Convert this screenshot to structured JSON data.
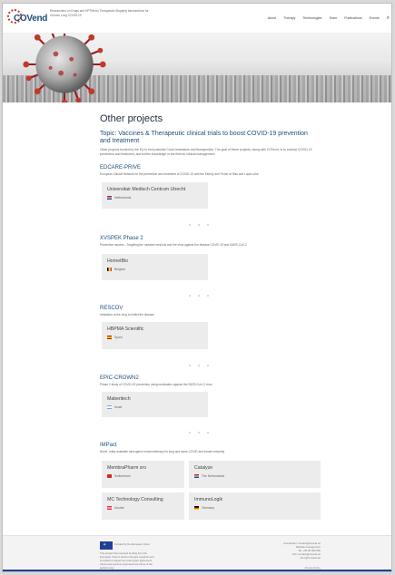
{
  "header": {
    "logo_text": "COVend",
    "tagline": "Researchers on Drugs and HPTMeUs Therapeutic Stopping Interventions for Chronic Long COVID-19",
    "nav": [
      "About",
      "Therapy",
      "Technologies",
      "Team",
      "Publications",
      "Events"
    ],
    "search_icon": "search-icon"
  },
  "main": {
    "title": "Other projects",
    "subtitle": "Topic: Vaccines & Therapeutic clinical trials to boost COVID-19 prevention and treatment",
    "intro": "Other projects funded by the EU to find potential Covid treatments and therapeutics. The goal of these projects, along with COVend, is to combat COVID-19 prevention and treatment, and further knowledge in the field for clinical management."
  },
  "projects": [
    {
      "title": "EDCARE-PRIVE",
      "description": "European Clinical Network for the prevention and treatment of COVID-19 with the Elderly and Those at Risk and Lupus-Like",
      "partners": [
        {
          "name": "Universitair Medisch Centrum Utrecht",
          "country": "Netherlands",
          "flag": "nl"
        }
      ]
    },
    {
      "title": "XVSPEK Phase 2",
      "description": "Preventive vaccine - Targeting the mutated versions and the virus against the disease COVID 19 and SARS-CoV-2",
      "partners": [
        {
          "name": "HornetBio",
          "country": "Belgium",
          "flag": "be"
        }
      ]
    },
    {
      "title": "RESCOV",
      "description": "Inhalation of the drug to inhibit the disease",
      "partners": [
        {
          "name": "HBPMA Scientific",
          "country": "Spain",
          "flag": "es"
        }
      ]
    },
    {
      "title": "EPIC-CROWN2",
      "description": "Phase 2 study of COVID-19 prevention using medication against the SARS-CoV-2 virus",
      "partners": [
        {
          "name": "Maberitech",
          "country": "Israel",
          "flag": "il"
        }
      ]
    },
    {
      "title": "IMPact",
      "description": "Novel, orally available tolerogenic immunotherapy for long and acute COVID and innate immunity",
      "partners": [
        {
          "name": "MembraPharm sro",
          "country": "Switzerland",
          "flag": "ch"
        },
        {
          "name": "Catalyze",
          "country": "The Netherlands",
          "flag": "nl"
        },
        {
          "name": "MC Technology Consulting",
          "country": "Austria",
          "flag": "at"
        },
        {
          "name": "ImmunoLogik",
          "country": "Germany",
          "flag": "de"
        }
      ]
    }
  ],
  "footer": {
    "eu_label": "Funded by the European Union",
    "funding_text": "This project has received funding from the European Union's Horizon Europe research and innovation programme under grant agreement. Views and opinions expressed are those of the authors only.",
    "contact": [
      "Coordinator: contact@covend.eu",
      "Website management",
      "Tel: +00 00 000 000",
      "Info: contact@covend.eu",
      "All rights reserved"
    ],
    "privacy": "Privacy Policy"
  },
  "colors": {
    "accent": "#1f4e79",
    "brand_red": "#c0392b",
    "card_bg": "#ececec",
    "eu_blue": "#1f3f99"
  }
}
